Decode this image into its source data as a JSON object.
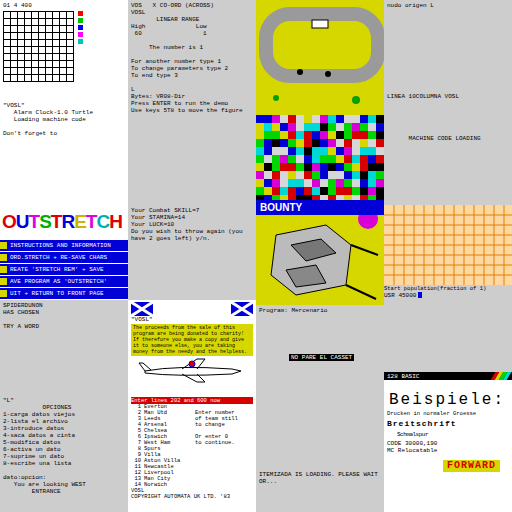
{
  "columns": [
    {
      "panels": [
        {
          "kind": "grid-chart",
          "title": "01 4 400",
          "legend": [
            {
              "color": "#ff0000"
            },
            {
              "color": "#00c000"
            },
            {
              "color": "#0000ff"
            },
            {
              "color": "#ff00ff"
            },
            {
              "color": "#00c0c0"
            }
          ]
        },
        {
          "kind": "text",
          "lines": [
            "\"VOSL\"",
            "   Alarm Clock-1.0 Turtle",
            "   Loading machine code",
            "",
            "Don't forget to"
          ]
        },
        {
          "kind": "logo-menu",
          "logo": [
            {
              "letter": "O",
              "color": "#e00000"
            },
            {
              "letter": "U",
              "color": "#0000e0"
            },
            {
              "letter": "T",
              "color": "#e000e0"
            },
            {
              "letter": "S",
              "color": "#00b000"
            },
            {
              "letter": "T",
              "color": "#e00000"
            },
            {
              "letter": "R",
              "color": "#0000e0"
            },
            {
              "letter": "E",
              "color": "#d0b000"
            },
            {
              "letter": "T",
              "color": "#e000e0"
            },
            {
              "letter": "C",
              "color": "#00b0b0"
            },
            {
              "letter": "H",
              "color": "#e00000"
            }
          ],
          "menu": [
            "INSTRUCTIONS AND INFORMATION",
            "ORD.STRETCH + RE-SAVE CHARS",
            "REATE 'STRETCH REM' + SAVE",
            "AVE PROGRAM AS 'OUTSTRETCH'",
            "UIT + RETURN TO FRONT PAGE"
          ]
        },
        {
          "kind": "text",
          "lines": [
            "SPIDERDUNON",
            "HAS CHOSEN",
            "",
            "TRY A WORD"
          ]
        },
        {
          "kind": "text",
          "lines": [
            "\"L\"",
            "           OPCIONES",
            "1-carga datos viejos",
            "2-lista el archivo",
            "3-introduce datos",
            "4-saca datos a cinta",
            "5-modifica datos",
            "6-activa un dato",
            "7-suprime un dato",
            "8-escribe una lista",
            "",
            "dato:opcion:",
            "   You are looking WEST",
            "        ENTRANCE"
          ]
        }
      ]
    },
    {
      "panels": [
        {
          "kind": "text",
          "lines": [
            "VOS   X CO-ORD (ACROSS)",
            "VOSL",
            "       LINEAR RANGE",
            "High              Low",
            " 60                 1",
            "",
            "     The number is 1",
            "",
            "For another number type 1",
            "To change parameters type 2",
            "To end type 3",
            "",
            "L",
            "Bytes: VR08-Dir",
            "Press ENTER to run the demo",
            "Use keys 5T8 to move the figure"
          ]
        },
        {
          "kind": "text",
          "lines": [
            "Your Combat SKILL=7",
            "Your STAMINA=14",
            "Your LUCK=10",
            "Do you wish to throw again (you",
            "have 2 goes left) y/n."
          ]
        },
        {
          "kind": "charity",
          "label": "\"VOSL\"",
          "text": "The proceeds from the sale of this program are being donated to charity! If therefore you make a copy and give it to someone else, you are taking money from the needy and the helpless."
        },
        {
          "kind": "teams",
          "header": "Enter lines 202 and 600 now",
          "teams": [
            {
              "num": "1",
              "name": "Everton"
            },
            {
              "num": "2",
              "name": "Man Utd"
            },
            {
              "num": "3",
              "name": "Leeds"
            },
            {
              "num": "4",
              "name": "Arsenal"
            },
            {
              "num": "5",
              "name": "Chelsea"
            },
            {
              "num": "6",
              "name": "Ipswich"
            },
            {
              "num": "7",
              "name": "West Ham"
            },
            {
              "num": "8",
              "name": "Spurs"
            },
            {
              "num": "9",
              "name": "Villa"
            },
            {
              "num": "10",
              "name": "Aston Villa"
            },
            {
              "num": "11",
              "name": "Newcastle"
            },
            {
              "num": "12",
              "name": "Liverpool"
            },
            {
              "num": "13",
              "name": "Man City"
            },
            {
              "num": "14",
              "name": "Norwich"
            }
          ],
          "prompt": [
            "Enter number",
            "of team still",
            "to change",
            "",
            "Or enter 0",
            "to continue."
          ],
          "footer": [
            "VOSL",
            "COPYRIGHT AUTOMATA UK LTD. '83"
          ]
        }
      ]
    },
    {
      "panels": [
        {
          "kind": "race"
        },
        {
          "kind": "noise"
        },
        {
          "kind": "bounty",
          "title": "BOUNTY"
        },
        {
          "kind": "loader",
          "program": "Program: Mercenario",
          "notice": "NO PARE EL CASSET",
          "status": "ITEMIZADA IS LOADING. PLEASE WAIT OR..."
        }
      ]
    },
    {
      "panels": [
        {
          "kind": "text",
          "lines": [
            "nudo origen L",
            "",
            "",
            "",
            "",
            "",
            "",
            "",
            "",
            "",
            "",
            "",
            "",
            "LINEA 10COLUMNA VOSL",
            "",
            "",
            "",
            "",
            "",
            "      MACHINE CODE LOADING"
          ]
        },
        {
          "kind": "population",
          "title": "Start population(fraction of 1)",
          "usr": "USR 45000"
        },
        {
          "kind": "basic",
          "title": "128 BASIC"
        },
        {
          "kind": "beispiele",
          "title": "Beispiele:",
          "normal": "Drucken in normaler Groesse",
          "wide": "Breitschrift",
          "narrow": "Schmalspur",
          "code": "CODE 30000,190",
          "mc": "MC Relocatable",
          "badge": "FORWARD"
        }
      ]
    }
  ]
}
